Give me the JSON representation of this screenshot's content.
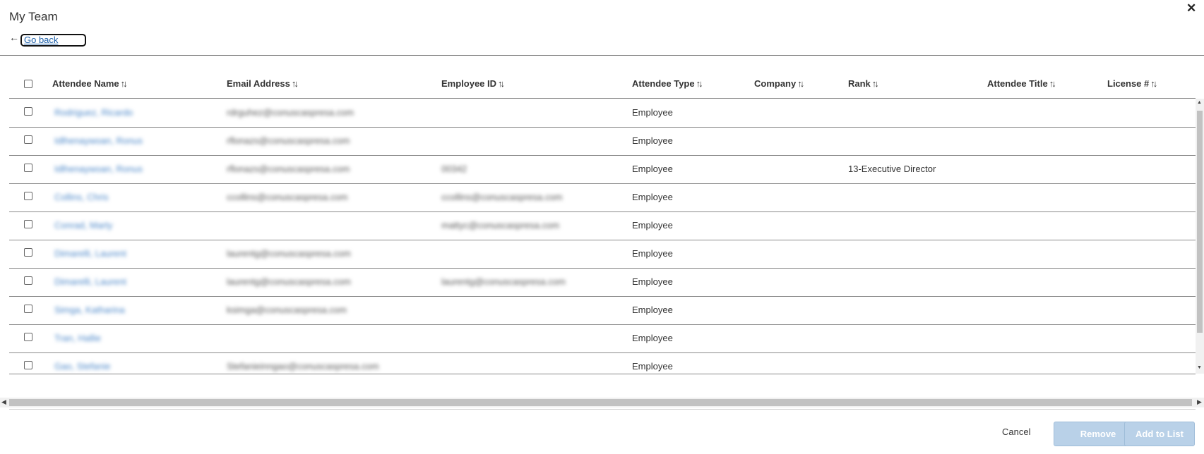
{
  "dialog": {
    "title": "My Team",
    "close_label": "✕",
    "back_arrow": "←",
    "back_label": "Go back"
  },
  "table": {
    "sort_glyph": "↑↓",
    "columns": [
      {
        "label": "Attendee Name"
      },
      {
        "label": "Email Address"
      },
      {
        "label": "Employee ID"
      },
      {
        "label": "Attendee Type"
      },
      {
        "label": "Company"
      },
      {
        "label": "Rank"
      },
      {
        "label": "Attendee Title"
      },
      {
        "label": "License #"
      }
    ],
    "rows": [
      {
        "name": "Rodriguez, Ricardo",
        "email": "rdrguhez@conuscaspresa.com",
        "employee_id": "",
        "type": "Employee",
        "rank": ""
      },
      {
        "name": "Idlhenaywoan, Ronus",
        "email": "rflonazs@conuscaspresa.com",
        "employee_id": "",
        "type": "Employee",
        "rank": ""
      },
      {
        "name": "Idlhenaywoan, Ronus",
        "email": "rflonazs@conuscaspresa.com",
        "employee_id": "00342",
        "type": "Employee",
        "rank": "13-Executive Director"
      },
      {
        "name": "Collins, Chris",
        "email": "ccollins@conuscaspresa.com",
        "employee_id": "ccollins@conuscaspresa.com",
        "type": "Employee",
        "rank": ""
      },
      {
        "name": "Conrad, Marty",
        "email": "",
        "employee_id": "mattyc@conuscaspresa.com",
        "type": "Employee",
        "rank": ""
      },
      {
        "name": "Dimarelli, Laurent",
        "email": "laurentg@conuscaspresa.com",
        "employee_id": "",
        "type": "Employee",
        "rank": ""
      },
      {
        "name": "Dimarelli, Laurent",
        "email": "laurentg@conuscaspresa.com",
        "employee_id": "laurentg@conuscaspresa.com",
        "type": "Employee",
        "rank": ""
      },
      {
        "name": "Simga, Katharina",
        "email": "ksimga@conuscaspresa.com",
        "employee_id": "",
        "type": "Employee",
        "rank": ""
      },
      {
        "name": "Tran, Hallie",
        "email": "",
        "employee_id": "",
        "type": "Employee",
        "rank": ""
      },
      {
        "name": "Gao, Stefanie",
        "email": "Stefanieinngao@conuscaspresa.com",
        "employee_id": "",
        "type": "Employee",
        "rank": ""
      }
    ]
  },
  "footer": {
    "cancel_label": "Cancel",
    "remove_label": "Remove",
    "add_label": "Add to List"
  },
  "colors": {
    "link": "#1a5ea8",
    "disabled_button": "#b9d1e8"
  }
}
